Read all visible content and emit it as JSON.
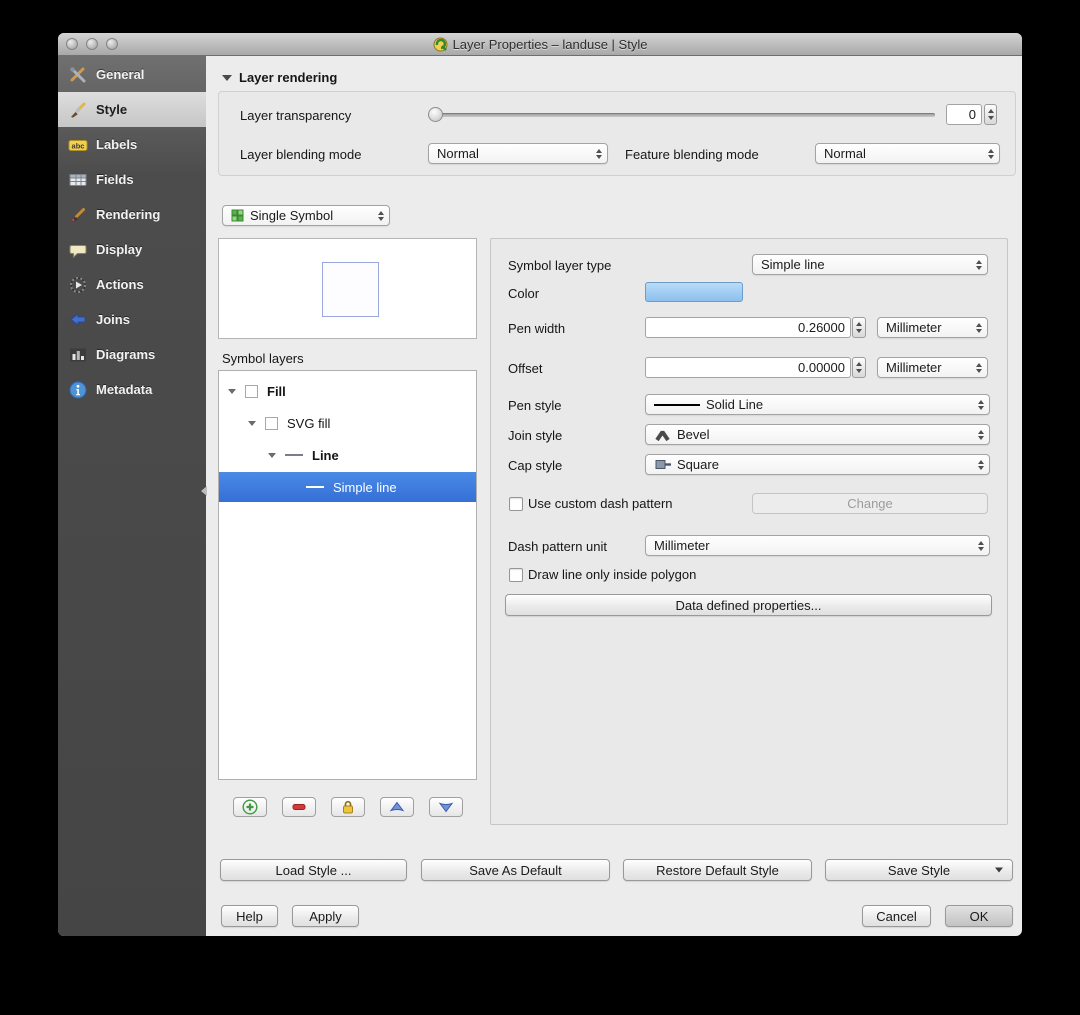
{
  "window": {
    "title": "Layer Properties – landuse | Style"
  },
  "sidebar": {
    "items": [
      {
        "label": "General"
      },
      {
        "label": "Style"
      },
      {
        "label": "Labels"
      },
      {
        "label": "Fields"
      },
      {
        "label": "Rendering"
      },
      {
        "label": "Display"
      },
      {
        "label": "Actions"
      },
      {
        "label": "Joins"
      },
      {
        "label": "Diagrams"
      },
      {
        "label": "Metadata"
      }
    ]
  },
  "rendering_section": {
    "title": "Layer rendering",
    "transparency_label": "Layer transparency",
    "transparency_value": "0",
    "layer_blending_label": "Layer blending mode",
    "layer_blending_value": "Normal",
    "feature_blending_label": "Feature blending mode",
    "feature_blending_value": "Normal"
  },
  "symbol_panel": {
    "renderer_value": "Single Symbol",
    "symbol_layers_label": "Symbol layers",
    "tree": [
      {
        "label": "Fill"
      },
      {
        "label": "SVG fill"
      },
      {
        "label": "Line"
      },
      {
        "label": "Simple line"
      }
    ]
  },
  "properties_panel": {
    "symbol_layer_type_label": "Symbol layer type",
    "symbol_layer_type_value": "Simple line",
    "color_label": "Color",
    "pen_width_label": "Pen width",
    "pen_width_value": "0.26000",
    "pen_width_unit": "Millimeter",
    "offset_label": "Offset",
    "offset_value": "0.00000",
    "offset_unit": "Millimeter",
    "pen_style_label": "Pen style",
    "pen_style_value": "Solid Line",
    "join_style_label": "Join style",
    "join_style_value": "Bevel",
    "cap_style_label": "Cap style",
    "cap_style_value": "Square",
    "custom_dash_label": "Use custom dash pattern",
    "change_button_label": "Change",
    "dash_pattern_unit_label": "Dash pattern unit",
    "dash_pattern_unit_value": "Millimeter",
    "draw_inside_label": "Draw line only inside polygon",
    "data_defined_button_label": "Data defined properties..."
  },
  "footer": {
    "load_style": "Load Style ...",
    "save_as_default": "Save As Default",
    "restore_default": "Restore Default Style",
    "save_style": "Save Style",
    "help": "Help",
    "apply": "Apply",
    "cancel": "Cancel",
    "ok": "OK"
  },
  "icons": {
    "labels_text": "abc"
  },
  "colors": {
    "selection": "#3d7ae5",
    "color_swatch": "#9ccaf2"
  }
}
